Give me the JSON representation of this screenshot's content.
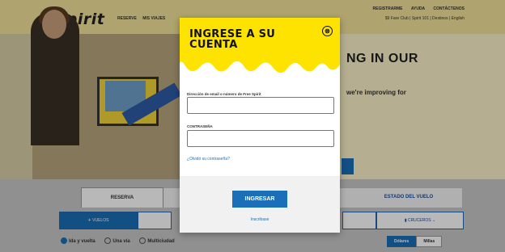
{
  "header": {
    "logo": "spirit",
    "nav_main": [
      "RESERVE",
      "MIS VIAJES"
    ],
    "nav_top": [
      "REGISTRARME",
      "AYUDA",
      "CONTÁCTENOS"
    ],
    "nav_sub": "$9 Fare Club | Spirit 101 | Destinos | English"
  },
  "hero": {
    "headline": "NG IN OUR",
    "subtext": "we're improving for"
  },
  "booking": {
    "tabs": {
      "reserva": "RESERVA",
      "estado": "ESTADO DEL VUELO"
    },
    "options": {
      "vuelos": "VUELOS",
      "cruceros": "CRUCEROS"
    },
    "trip_types": [
      "Ida y vuelta",
      "Una vía",
      "Multiciudad"
    ],
    "currency": [
      "Dólares",
      "Millas"
    ]
  },
  "modal": {
    "title": "INGRESE A SU CUENTA",
    "close_symbol": "⊗",
    "email_label": "Dirección de email o número de Free Spirit",
    "password_label": "CONTRASEÑA",
    "email_value": "",
    "password_value": "",
    "forgot_link": "¿Olvidó su contraseña?",
    "login_button": "INGRESAR",
    "signup_link": "Inscribase"
  },
  "colors": {
    "accent_yellow": "#FFE300",
    "primary_blue": "#1A6FB8"
  }
}
